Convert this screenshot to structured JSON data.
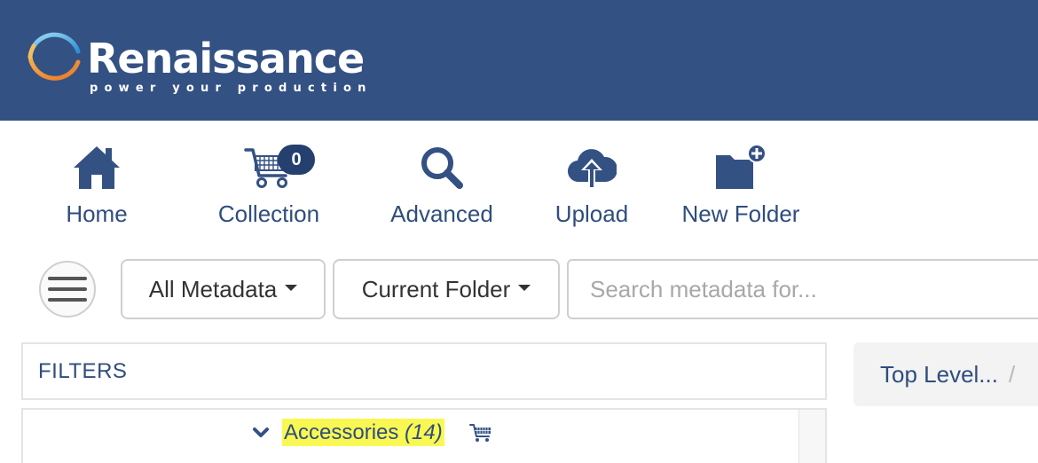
{
  "brand": {
    "name": "Renaissance",
    "tagline": "power your production"
  },
  "toolbar": {
    "home": "Home",
    "collection": "Collection",
    "collection_count": "0",
    "advanced": "Advanced",
    "upload": "Upload",
    "new_folder": "New Folder"
  },
  "search_bar": {
    "field_select": "All Metadata",
    "scope_select": "Current Folder",
    "placeholder": "Search metadata for..."
  },
  "filters": {
    "title": "FILTERS",
    "items": [
      {
        "label": "Accessories",
        "count": "(14)"
      }
    ]
  },
  "breadcrumb": {
    "top": "Top Level...",
    "separator": "/"
  },
  "colors": {
    "header": "#345184",
    "accent": "#2f4d7e",
    "highlight": "#f9f852"
  }
}
